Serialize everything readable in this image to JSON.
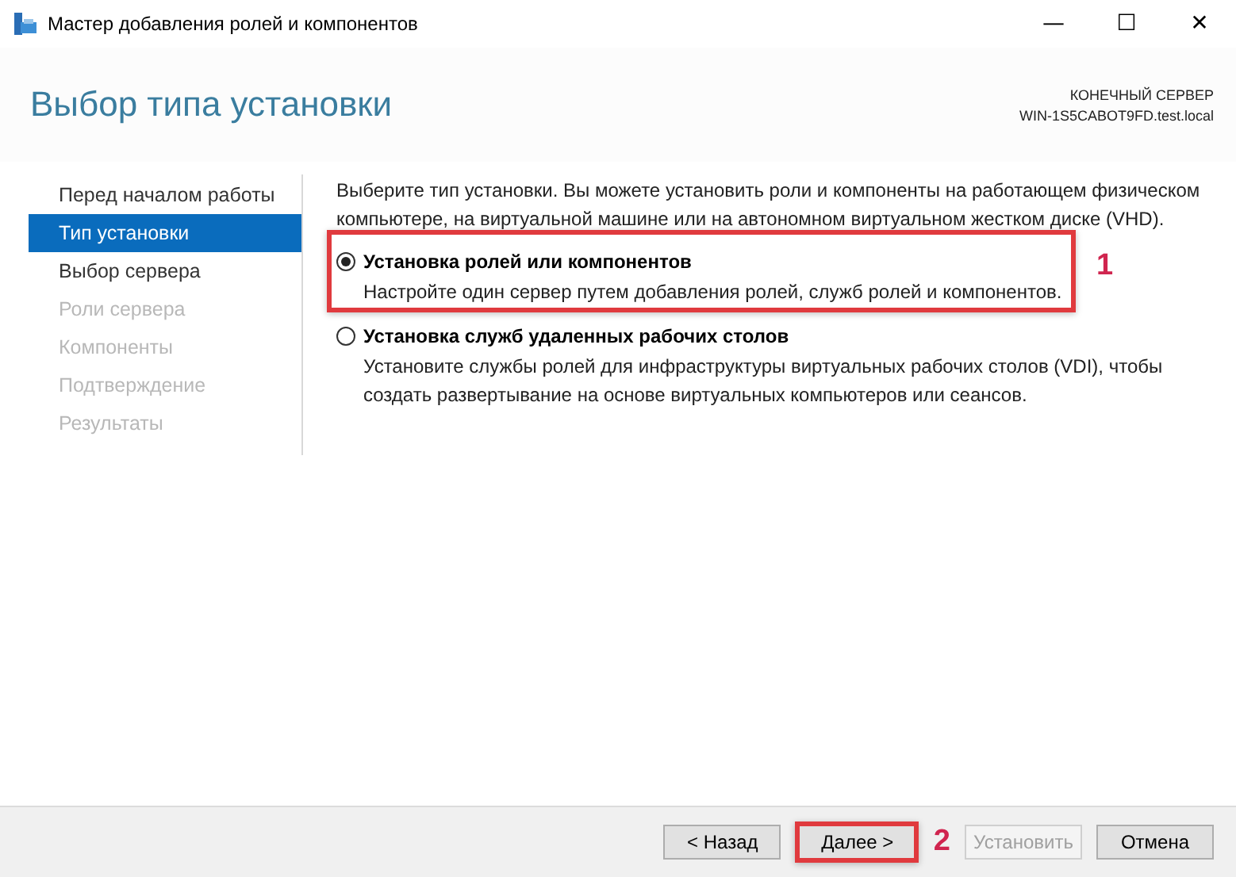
{
  "window": {
    "title": "Мастер добавления ролей и компонентов",
    "controls": [
      "—",
      "☐",
      "✕"
    ]
  },
  "header": {
    "title": "Выбор типа установки",
    "target_label": "КОНЕЧНЫЙ СЕРВЕР",
    "target_server": "WIN-1S5CABOT9FD.test.local"
  },
  "sidebar": {
    "items": [
      {
        "label": "Перед началом работы",
        "selected": false,
        "disabled": false
      },
      {
        "label": "Тип установки",
        "selected": true,
        "disabled": false
      },
      {
        "label": "Выбор сервера",
        "selected": false,
        "disabled": false
      },
      {
        "label": "Роли сервера",
        "selected": false,
        "disabled": true
      },
      {
        "label": "Компоненты",
        "selected": false,
        "disabled": true
      },
      {
        "label": "Подтверждение",
        "selected": false,
        "disabled": true
      },
      {
        "label": "Результаты",
        "selected": false,
        "disabled": true
      }
    ]
  },
  "intro": "Выберите тип установки. Вы можете установить роли и компоненты на работающем физическом компьютере, на виртуальной машине или на автономном виртуальном жестком диске (VHD).",
  "options": [
    {
      "title": "Установка ролей или компонентов",
      "description": "Настройте один сервер путем добавления ролей, служб ролей и компонентов.",
      "selected": true,
      "highlighted": true,
      "marker": "1"
    },
    {
      "title": "Установка служб удаленных рабочих столов",
      "description": "Установите службы ролей для инфраструктуры виртуальных рабочих столов (VDI), чтобы создать развертывание на основе виртуальных компьютеров или сеансов.",
      "selected": false,
      "highlighted": false
    }
  ],
  "buttons": [
    {
      "label": "< Назад",
      "disabled": false,
      "highlighted": false
    },
    {
      "label": "Далее >",
      "disabled": false,
      "highlighted": true,
      "marker": "2"
    },
    {
      "label": "Установить",
      "disabled": true,
      "highlighted": false
    },
    {
      "label": "Отмена",
      "disabled": false,
      "highlighted": false
    }
  ]
}
